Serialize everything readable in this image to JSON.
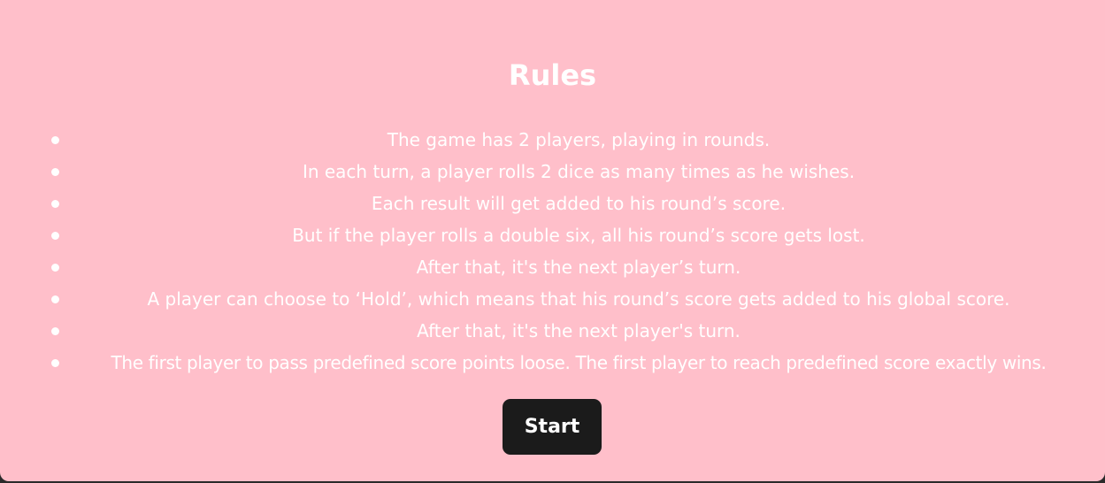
{
  "title": "Rules",
  "rules": [
    "The game has 2 players, playing in rounds.",
    "In each turn, a player rolls 2 dice as many times as he wishes.",
    "Each result will get added to his round’s score.",
    "But if the player rolls a double six, all his round’s score gets lost.",
    "After that, it's the next player’s turn.",
    "A player can choose to ‘Hold’, which means that his round’s score gets added to his global score.",
    "After that, it's the next player's turn.",
    "The first player to pass predefined score points loose. The first player to reach predefined score exactly wins."
  ],
  "start_label": "Start",
  "colors": {
    "panel_background": "#ffbfca",
    "text": "#ffffff",
    "button_background": "#1b1b1b",
    "page_background": "#2a2a2a"
  }
}
